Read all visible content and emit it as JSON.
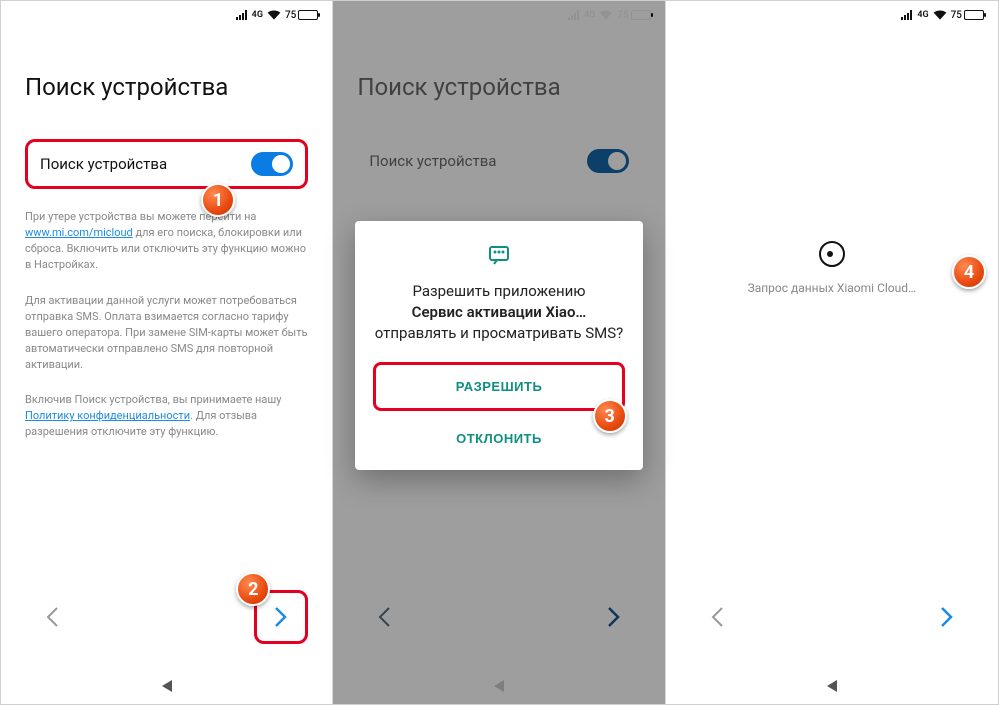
{
  "statusbar": {
    "net": "4G",
    "battery_pct": "75"
  },
  "screen1": {
    "title": "Поиск устройства",
    "toggle_label": "Поиск устройства",
    "info1_pre": "При утере устройства вы можете перейти на ",
    "info1_link": "www.mi.com/micloud",
    "info1_post": " для его поиска, блокировки или сброса. Включить или отключить эту функцию можно в Настройках.",
    "info2": "Для активации данной услуги может потребоваться отправка SMS. Оплата взимается согласно тарифу вашего оператора. При замене SIM-карты может быть автоматически отправлено SMS для повторной активации.",
    "info3_pre": "Включив Поиск устройства, вы принимаете нашу ",
    "info3_link": "Политику конфиденциальности",
    "info3_post": ". Для отзыва разрешения отключите эту функцию."
  },
  "screen2": {
    "title": "Поиск устройства",
    "toggle_label": "Поиск устройства",
    "dialog_line1": "Разрешить приложению",
    "dialog_line2_bold": "Сервис активации Xiao…",
    "dialog_line3": "отправлять и просматривать SMS?",
    "btn_allow": "РАЗРЕШИТЬ",
    "btn_deny": "ОТКЛОНИТЬ"
  },
  "screen3": {
    "loading": "Запрос данных Xiaomi Cloud…"
  },
  "badges": {
    "b1": "1",
    "b2": "2",
    "b3": "3",
    "b4": "4"
  }
}
